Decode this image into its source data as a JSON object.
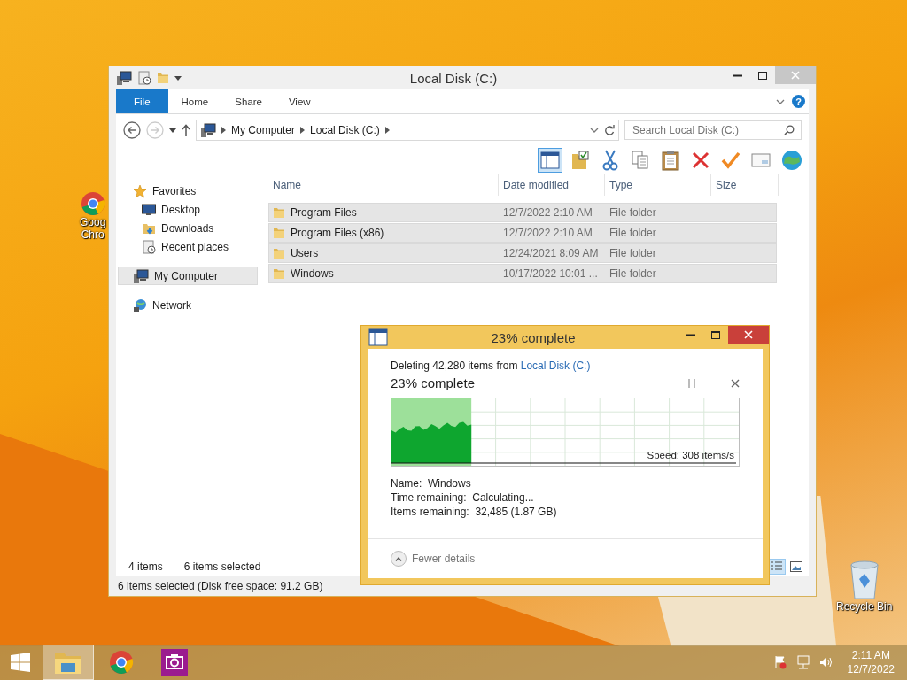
{
  "desktop_icons": [
    {
      "kind": "chrome",
      "label_lines": [
        "Goog",
        "Chro"
      ]
    },
    {
      "kind": "recycle",
      "label_lines": [
        "Recycle Bin"
      ]
    }
  ],
  "explorer": {
    "title": "Local Disk (C:)",
    "ribbon_tabs": [
      {
        "label": "File",
        "kind": "file"
      },
      {
        "label": "Home",
        "kind": "tab"
      },
      {
        "label": "Share",
        "kind": "tab"
      },
      {
        "label": "View",
        "kind": "tab"
      }
    ],
    "help_label": "?",
    "address": {
      "crumbs": [
        "My Computer",
        "Local Disk (C:)"
      ]
    },
    "search": {
      "placeholder": "Search Local Disk (C:)"
    },
    "toolbar_buttons": [
      {
        "kind": "pane",
        "selected": true
      },
      {
        "kind": "properties",
        "selected": false
      },
      {
        "kind": "cut",
        "selected": false
      },
      {
        "kind": "copy",
        "selected": false
      },
      {
        "kind": "paste",
        "selected": false
      },
      {
        "kind": "delete",
        "selected": false
      },
      {
        "kind": "check",
        "selected": false
      },
      {
        "kind": "mail",
        "selected": false
      },
      {
        "kind": "globe",
        "selected": false
      }
    ],
    "nav": [
      {
        "label": "Favorites",
        "kind": "star",
        "selected": false,
        "children": [
          {
            "label": "Desktop",
            "kind": "desktop",
            "selected": false
          },
          {
            "label": "Downloads",
            "kind": "downloads",
            "selected": false
          },
          {
            "label": "Recent places",
            "kind": "recent",
            "selected": false
          }
        ]
      },
      {
        "label": "My Computer",
        "kind": "computer",
        "selected": true
      },
      {
        "label": "Network",
        "kind": "network",
        "selected": false
      }
    ],
    "columns": [
      "Name",
      "Date modified",
      "Type",
      "Size"
    ],
    "rows": [
      {
        "name": "Program Files",
        "date": "12/7/2022 2:10 AM",
        "type": "File folder",
        "selected": true
      },
      {
        "name": "Program Files (x86)",
        "date": "12/7/2022 2:10 AM",
        "type": "File folder",
        "selected": true
      },
      {
        "name": "Users",
        "date": "12/24/2021 8:09 AM",
        "type": "File folder",
        "selected": true
      },
      {
        "name": "Windows",
        "date": "10/17/2022 10:01 ...",
        "type": "File folder",
        "selected": true
      }
    ],
    "item_count": "4 items",
    "selection_count": "6 items selected",
    "status_bar": "6 items selected (Disk free space: 91.2 GB)",
    "view_buttons": [
      {
        "kind": "details",
        "selected": true
      },
      {
        "kind": "large_icons",
        "selected": false
      }
    ]
  },
  "dialog": {
    "title": "23% complete",
    "description": "Deleting 42,280 items from ",
    "source_link": "Local Disk (C:)",
    "progress_text": "23% complete",
    "graph": {
      "level": 0.23,
      "speed": "Speed: 308 items/s"
    },
    "details": [
      {
        "label": "Name:",
        "value": "Windows"
      },
      {
        "label": "Time remaining:",
        "value": "Calculating..."
      },
      {
        "label": "Items remaining:",
        "value": "32,485 (1.87 GB)"
      }
    ],
    "toggle": "Fewer details"
  },
  "taskbar": {
    "apps": [
      {
        "kind": "explorer",
        "selected": true
      },
      {
        "kind": "chrome",
        "selected": false
      },
      {
        "kind": "camera",
        "selected": false
      }
    ],
    "tray": [
      {
        "kind": "flag"
      },
      {
        "kind": "network"
      },
      {
        "kind": "volume"
      }
    ],
    "time": "2:11 AM",
    "date": "12/7/2022"
  }
}
